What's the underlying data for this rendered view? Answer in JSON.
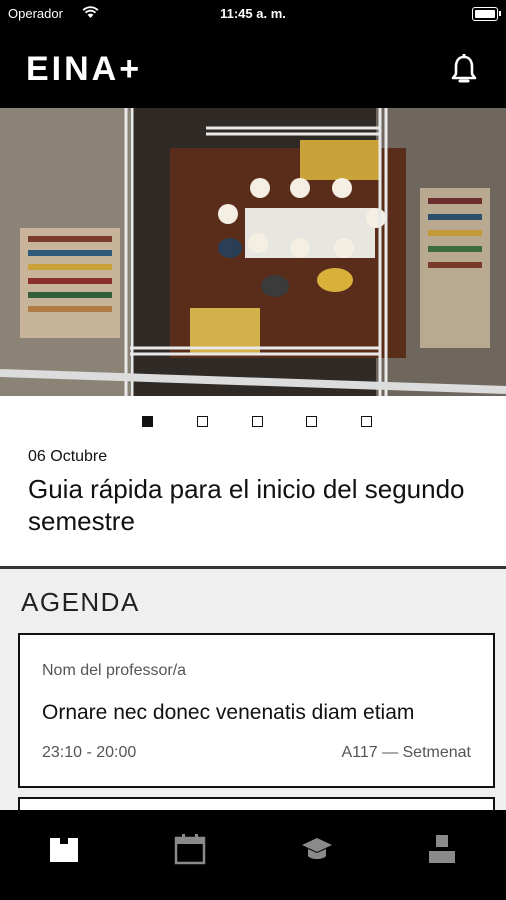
{
  "status_bar": {
    "carrier": "Operador",
    "time": "11:45 a. m.",
    "icons": [
      "wifi-icon",
      "battery-icon"
    ]
  },
  "header": {
    "logo": "EINA+",
    "icons": [
      "bell-icon"
    ]
  },
  "carousel": {
    "slide_count": 5,
    "active_index": 0
  },
  "news": {
    "date": "06 Octubre",
    "title": "Guia rápida para el inicio del segundo semestre"
  },
  "agenda": {
    "title": "AGENDA",
    "items": [
      {
        "teacher": "Nom del professor/a",
        "subject": "Ornare nec donec venenatis diam etiam",
        "time": "23:10 - 20:00",
        "location": "A117 — Setmenat"
      }
    ]
  },
  "tab_bar": {
    "tabs": [
      {
        "icon": "home-icon",
        "active": true
      },
      {
        "icon": "calendar-icon",
        "active": false
      },
      {
        "icon": "graduation-cap-icon",
        "active": false
      },
      {
        "icon": "user-icon",
        "active": false
      }
    ]
  },
  "colors": {
    "bar_background": "#000000",
    "active_tab": "#ffffff",
    "inactive_tab": "#8a8a8a",
    "agenda_background": "#efefef"
  }
}
